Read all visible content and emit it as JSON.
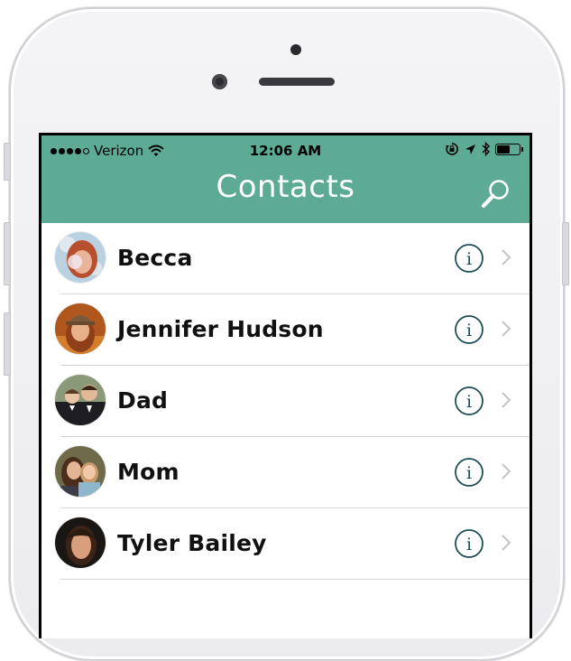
{
  "theme": {
    "teal": "#5dab95",
    "info_color": "#1f4d55",
    "chevron_color": "#c4c4c8"
  },
  "status_bar": {
    "carrier": "Verizon",
    "time": "12:06 AM",
    "signal_bars": 4,
    "icons": [
      "signal-dots-icon",
      "wifi-icon",
      "orientation-lock-icon",
      "location-arrow-icon",
      "bluetooth-icon",
      "battery-icon"
    ],
    "battery_level": 0.55
  },
  "nav": {
    "title": "Contacts",
    "search_icon": "search-icon"
  },
  "contacts": [
    {
      "name": "Becca"
    },
    {
      "name": "Jennifer Hudson"
    },
    {
      "name": "Dad"
    },
    {
      "name": "Mom"
    },
    {
      "name": "Tyler Bailey"
    }
  ],
  "row_icons": {
    "info": "info-icon",
    "disclosure": "chevron-right-icon"
  }
}
